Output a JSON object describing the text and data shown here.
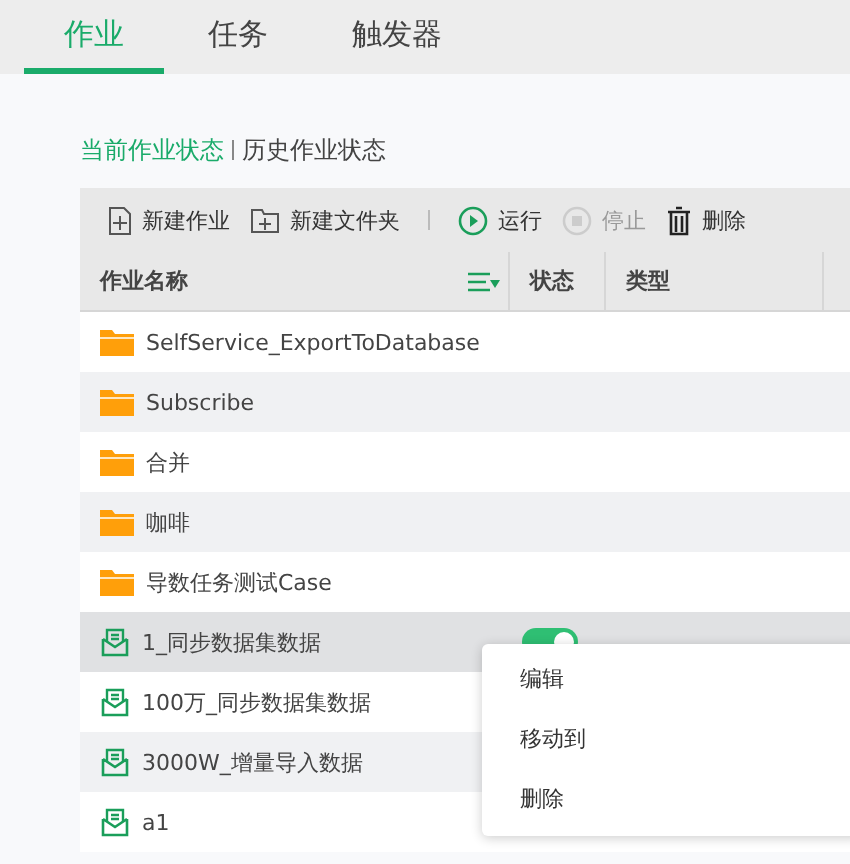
{
  "tabs": [
    {
      "label": "作业",
      "selected": true
    },
    {
      "label": "任务",
      "selected": false
    },
    {
      "label": "触发器",
      "selected": false
    }
  ],
  "views": [
    {
      "label": "当前作业状态",
      "selected": true
    },
    {
      "label": "历史作业状态",
      "selected": false
    }
  ],
  "toolbar": [
    {
      "kind": "button",
      "label": "新建作业",
      "disabled": false
    },
    {
      "kind": "button",
      "label": "新建文件夹",
      "disabled": false
    },
    {
      "kind": "separator"
    },
    {
      "kind": "button",
      "label": "运行",
      "disabled": false
    },
    {
      "kind": "button",
      "label": "停止",
      "disabled": true
    },
    {
      "kind": "button",
      "label": "删除",
      "disabled": false
    }
  ],
  "table": {
    "columns": [
      "作业名称",
      "状态",
      "类型"
    ],
    "rows": [
      {
        "kind": "folder",
        "name": "SelfService_ExportToDatabase",
        "selected": false
      },
      {
        "kind": "folder",
        "name": "Subscribe",
        "selected": false
      },
      {
        "kind": "folder",
        "name": "合并",
        "selected": false
      },
      {
        "kind": "folder",
        "name": "咖啡",
        "selected": false
      },
      {
        "kind": "folder",
        "name": "导数任务测试Case",
        "selected": false
      },
      {
        "kind": "job",
        "name": "1_同步数据集数据",
        "selected": true,
        "on": true
      },
      {
        "kind": "job",
        "name": "100万_同步数据集数据",
        "selected": false
      },
      {
        "kind": "job",
        "name": "3000W_增量导入数据",
        "selected": false
      },
      {
        "kind": "job",
        "name": "a1",
        "selected": false
      }
    ]
  },
  "context_menu": [
    "编辑",
    "移动到",
    "删除"
  ]
}
